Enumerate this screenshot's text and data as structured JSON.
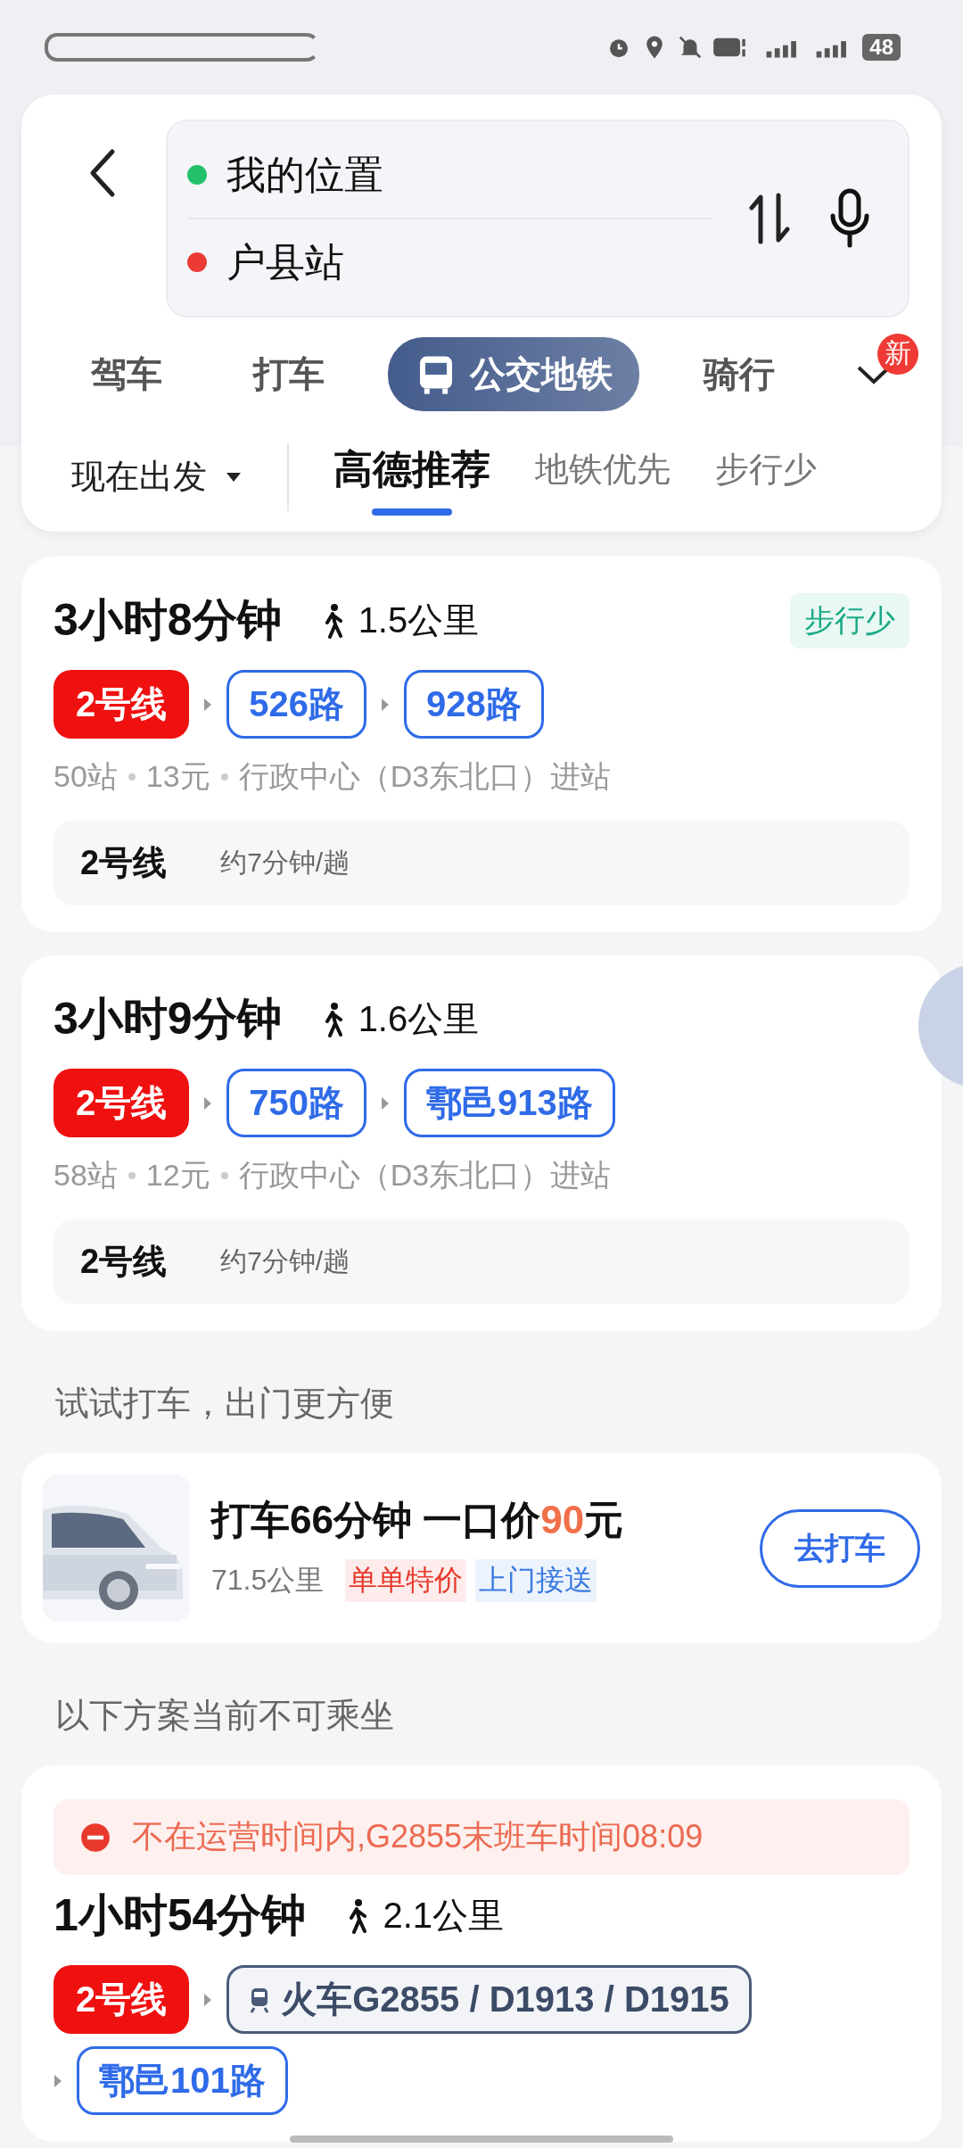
{
  "status_bar": {
    "battery": "48"
  },
  "search": {
    "origin": "我的位置",
    "destination": "户县站"
  },
  "modes": [
    {
      "label": "驾车",
      "selected": false
    },
    {
      "label": "打车",
      "selected": false
    },
    {
      "label": "公交地铁",
      "selected": true
    },
    {
      "label": "骑行",
      "selected": false
    }
  ],
  "more_badge": "新",
  "depart": "现在出发",
  "sort_tabs": [
    {
      "label": "高德推荐",
      "selected": true
    },
    {
      "label": "地铁优先",
      "selected": false
    },
    {
      "label": "步行少",
      "selected": false
    }
  ],
  "routes": [
    {
      "duration": "3小时8分钟",
      "walk": "1.5公里",
      "badge": "步行少",
      "segments": [
        {
          "kind": "subway",
          "label": "2号线"
        },
        {
          "kind": "bus",
          "label": "526路"
        },
        {
          "kind": "bus",
          "label": "928路"
        }
      ],
      "details": [
        "50站",
        "13元",
        "行政中心（D3东北口）进站"
      ],
      "line": {
        "name": "2号线",
        "frequency": "约7分钟/趟"
      }
    },
    {
      "duration": "3小时9分钟",
      "walk": "1.6公里",
      "segments": [
        {
          "kind": "subway",
          "label": "2号线"
        },
        {
          "kind": "bus",
          "label": "750路"
        },
        {
          "kind": "bus",
          "label": "鄠邑913路"
        }
      ],
      "details": [
        "58站",
        "12元",
        "行政中心（D3东北口）进站"
      ],
      "line": {
        "name": "2号线",
        "frequency": "约7分钟/趟"
      }
    }
  ],
  "taxi_heading": "试试打车，出门更方便",
  "taxi": {
    "title_prefix": "打车66分钟 一口价",
    "price": "90",
    "title_suffix": "元",
    "distance": "71.5公里",
    "tags": [
      {
        "label": "单单特价",
        "color": "#e8392c"
      },
      {
        "label": "上门接送",
        "color": "#3a7be0"
      }
    ],
    "button": "去打车"
  },
  "unavailable_heading": "以下方案当前不可乘坐",
  "unavailable_routes": [
    {
      "notice": "不在运营时间内,G2855末班车时间08:09",
      "duration": "1小时54分钟",
      "walk": "2.1公里",
      "segments": [
        {
          "kind": "subway",
          "label": "2号线"
        },
        {
          "kind": "train",
          "label": "火车G2855 / D1913 / D1915"
        },
        {
          "kind": "bus",
          "label": "鄠邑101路"
        }
      ]
    }
  ]
}
